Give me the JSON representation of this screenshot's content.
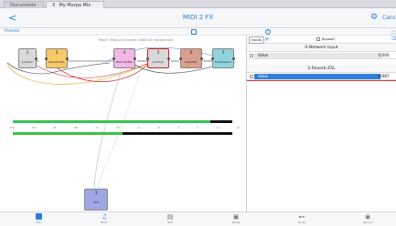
{
  "tabs": [
    {
      "label": "Documents"
    },
    {
      "label": "My Morpa Mix UG",
      "close": "X"
    }
  ],
  "nav": {
    "back": "<",
    "title": "MIDI 2 FX",
    "cancel": "Canc"
  },
  "toolbar": {
    "presets": "Presets",
    "help": "?"
  },
  "graph": {
    "hint": "Move / Right-click node, Add/Click background",
    "nodes": [
      {
        "num": "1",
        "label": "Junction",
        "color": "#d9d9d9"
      },
      {
        "num": "2",
        "label": "Reverb ZXL",
        "color": "#f7c967"
      },
      {
        "num": "4",
        "label": "Pitch Shifter",
        "color": "#f1b8e6"
      },
      {
        "num": "5",
        "label": "Junction",
        "color": "#d9d9d9"
      },
      {
        "num": "6",
        "label": "Amplifier",
        "color": "#d9a08d"
      },
      {
        "num": "7",
        "label": "Compressor",
        "color": "#8fd4dc"
      },
      {
        "num": "3",
        "label": "LFO",
        "color": "#9fa6e6"
      }
    ],
    "scale": [
      "-100",
      "-60",
      "-48",
      "-36",
      "-24",
      "-18",
      "-12",
      "-6",
      "-3",
      "0",
      "+3",
      "+6"
    ],
    "meter": {
      "top_level": 0.9,
      "bottom_level": 0.5
    }
  },
  "inspector": {
    "tab": "Inputs",
    "add": "+",
    "bypass": "Bypass?",
    "delete": "⌫",
    "sections": [
      {
        "title": "0-Network Input",
        "param": "Value",
        "value": "0.000",
        "level": 0.0
      },
      {
        "title": "2-Reverb ZXL",
        "param": "Value",
        "value": "0.987",
        "level": 0.987
      }
    ]
  },
  "tabbar": [
    {
      "label": "LFO",
      "icon": "square-icon"
    },
    {
      "label": "Music",
      "icon": "note-icon"
    },
    {
      "label": "Text",
      "icon": "doc-icon"
    },
    {
      "label": "Media",
      "icon": "image-icon"
    },
    {
      "label": "Morph",
      "icon": "morph-icon"
    },
    {
      "label": "Record",
      "icon": "record-icon"
    }
  ],
  "colors": {
    "accent": "#2f7fd6",
    "red": "#d33333",
    "green": "#39c24a"
  }
}
